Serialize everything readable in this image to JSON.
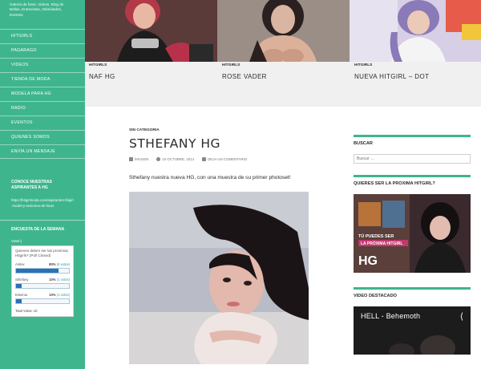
{
  "sidebar": {
    "description": "Galería de fotos, Videos, Blog de Bellas, Entrevistas, Intimidades, Eventos",
    "nav": [
      "HITGIRLS",
      "PAGARAGO",
      "VIDEOS",
      "TIENDA DE MODA",
      "MODELA PARA HG",
      "RADIO",
      "EVENTOS",
      "QUIENES SOMOS",
      "ENVÍA UN MENSAJE"
    ],
    "aspirants_title": "CONOCE NUESTRAS ASPIRANTES A HG",
    "aspirants_link": "https://hitgirlmoda.com/aspirantes-hitgirl-model-y-sesiones-de-fotos",
    "poll_title": "ENCUESTA DE LA SEMANA",
    "poll_label": "Vote!:)",
    "poll_question": "Quienes deben ser las proximas Hitgirls? (Poll Closed)",
    "poll_options": [
      {
        "name": "Ariitex",
        "pct": "80%",
        "count": "(8 votos)",
        "fill": 0.8
      },
      {
        "name": "Sthefany",
        "pct": "10%",
        "count": "(1 votos)",
        "fill": 0.1
      },
      {
        "name": "Essenia",
        "pct": "10%",
        "count": "(1 votos)",
        "fill": 0.1
      }
    ],
    "poll_total": "Total Votos: 10"
  },
  "featured": [
    {
      "category": "HITGIRLS",
      "title": "NAF HG"
    },
    {
      "category": "HITGIRLS",
      "title": "ROSE VADER"
    },
    {
      "category": "HITGIRLS",
      "title": "NUEVA HITGIRL – DOT"
    }
  ],
  "post": {
    "category": "SIN CATEGORIA",
    "title": "STHEFANY HG",
    "meta_format": "IMAGEN",
    "meta_date": "10 OCTUBRE, 2014",
    "meta_comments": "DEJA UN COMENTARIO",
    "excerpt": "Sthefany nuestra nueva HG, con una muestra de su primer photoset!"
  },
  "right": {
    "search_title": "BUSCAR",
    "search_placeholder": "Buscar …",
    "hitgirl_title": "QUIERES SER LA PROXIMA HITGIRL?",
    "banner_line1": "TÚ PUEDES SER",
    "banner_line2": "LA PRÓXIMA HITGIRL",
    "banner_logo": "HG",
    "video_section_title": "VIDEO DESTACADO",
    "video_title": "HELL - Behemoth"
  },
  "colors": {
    "accent": "#3fb58e",
    "poll_bar": "#2a72b5"
  }
}
